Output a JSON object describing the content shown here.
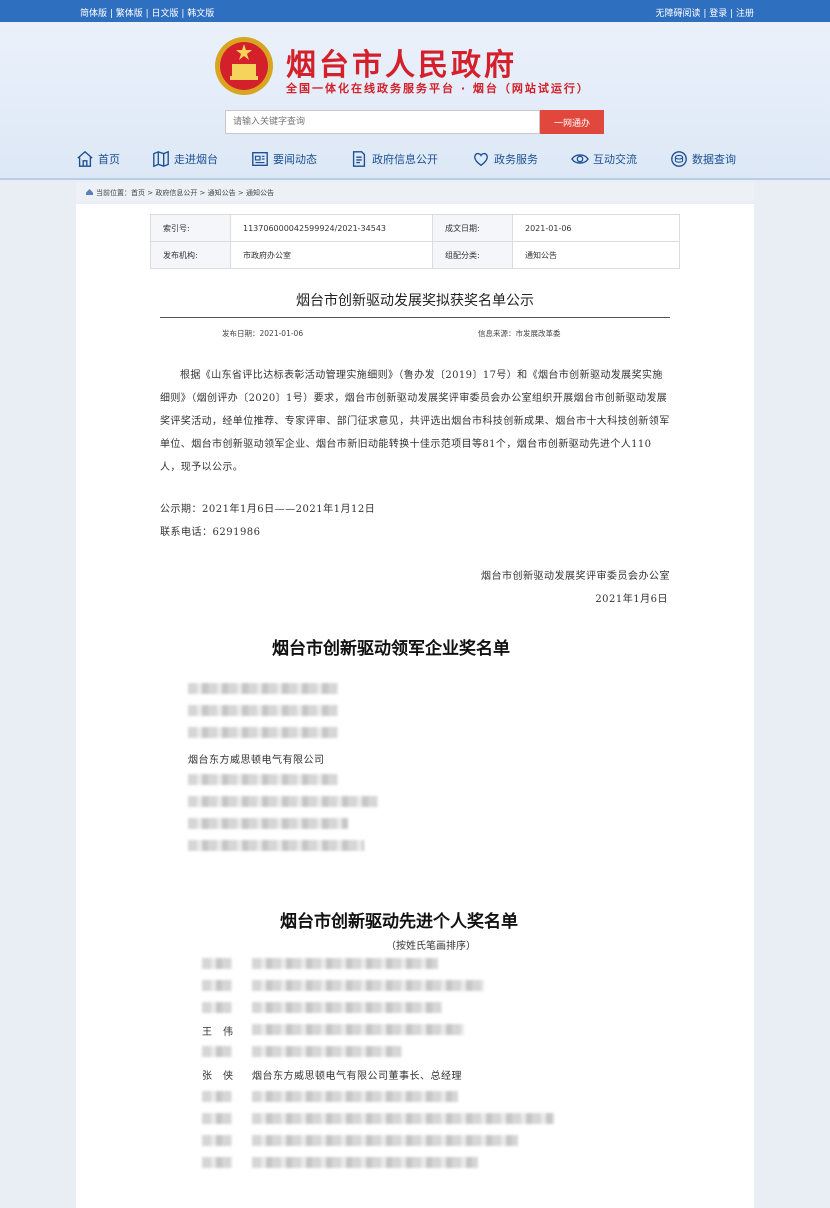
{
  "topbar": {
    "langs": "简体版 | 繁体版 | 日文版 | 韩文版",
    "accessibility": "无障碍阅读 | 登录 | 注册"
  },
  "header": {
    "title": "烟台市人民政府",
    "subtitle": "全国一体化在线政务服务平台 · 烟台（网站试运行）"
  },
  "search": {
    "placeholder": "请输入关键字查询",
    "button": "一网通办"
  },
  "nav": {
    "items": [
      "首页",
      "走进烟台",
      "要闻动态",
      "政府信息公开",
      "政务服务",
      "互动交流",
      "数据查询"
    ]
  },
  "breadcrumb": "当前位置：首页 > 政府信息公开 > 通知公告 > 通知公告",
  "meta": {
    "index_label": "索引号:",
    "index_value": "113706000042599924/2021-34543",
    "date_label": "成文日期:",
    "date_value": "2021-01-06",
    "org_label": "发布机构:",
    "org_value": "市政府办公室",
    "category_label": "组配分类:",
    "category_value": "通知公告"
  },
  "doc": {
    "title": "烟台市创新驱动发展奖拟获奖名单公示",
    "pubdate": "发布日期：2021-01-06",
    "source": "信息来源：市发展改革委",
    "body": "根据《山东省评比达标表彰活动管理实施细则》（鲁办发〔2019〕17号）和《烟台市创新驱动发展奖实施细则》（烟创评办〔2020〕1号）要求，烟台市创新驱动发展奖评审委员会办公室组织开展烟台市创新驱动发展奖评奖活动，经单位推荐、专家评审、部门征求意见，共评选出烟台市科技创新成果、烟台市十大科技创新领军单位、烟台市创新驱动领军企业、烟台市新旧动能转换十佳示范项目等81个，烟台市创新驱动先进个人110人，现予以公示。",
    "period": "公示期：2021年1月6日——2021年1月12日",
    "phone": "联系电话：6291986",
    "signer": "烟台市创新驱动发展奖评审委员会办公室",
    "sign_date": "2021年1月6日",
    "section1_title": "烟台市创新驱动领军企业奖名单",
    "section1_visible": "烟台东方威思顿电气有限公司",
    "section2_title": "烟台市创新驱动先进个人奖名单",
    "section2_note": "（按姓氏笔画排序）",
    "p_wang_name": "王　伟",
    "p_zhang_name": "张　侠",
    "p_zhang_title": "烟台东方威思顿电气有限公司董事长、总经理"
  }
}
